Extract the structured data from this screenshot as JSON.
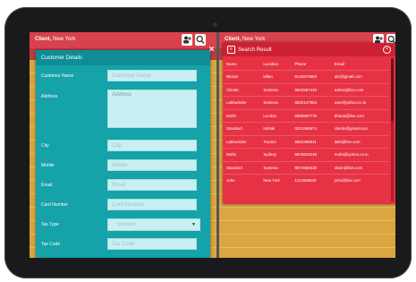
{
  "left": {
    "topbar_title": "Client,",
    "topbar_location": "New York",
    "panel_title": "Customer Details",
    "fields": [
      {
        "label": "Customer Name",
        "placeholder": "Customer Name"
      },
      {
        "label": "Address",
        "placeholder": "Address"
      },
      {
        "label": "City",
        "placeholder": "City"
      },
      {
        "label": "Mobile",
        "placeholder": "Mobile"
      },
      {
        "label": "Email",
        "placeholder": "Email"
      },
      {
        "label": "Card Number",
        "placeholder": "Card Number"
      },
      {
        "label": "Tax Type",
        "value": "Standard"
      },
      {
        "label": "Tax Code",
        "placeholder": "Tax Code"
      }
    ],
    "close": "×"
  },
  "right": {
    "topbar_title": "Client,",
    "topbar_location": "New York",
    "search_title": "Search Result",
    "columns": [
      "Name",
      "Location",
      "Phone",
      "Email"
    ],
    "rows": [
      [
        "Bharat",
        "Milan",
        "8125874963",
        "abr@gmail.com"
      ],
      [
        "Cliente",
        "Santena",
        "9632587410",
        "admin@live.com"
      ],
      [
        "Lakhwinder",
        "Santena",
        "8520147963",
        "user@yahoo.co.in"
      ],
      [
        "Mohit",
        "London",
        "9998887776",
        "bharat@live.com"
      ],
      [
        "Standard",
        "Mohali",
        "0021569874",
        "cliente@gmail.com"
      ],
      [
        "Lakhwinder",
        "Toronto",
        "8862366911",
        "lakh@live.com"
      ],
      [
        "Mohit",
        "Sydney",
        "9876543218",
        "mohit@yahoo.co.in"
      ],
      [
        "Standard",
        "Santena",
        "9874556630",
        "stann@live.com"
      ],
      [
        "John",
        "New York",
        "1112589630",
        "john@live.com"
      ]
    ]
  },
  "colors": {
    "topbar": "#d9424c",
    "panel": "#15a2a8",
    "search_panel": "#e73244",
    "background": "#d9a63f"
  },
  "icons": {
    "add_user": "add-user-icon",
    "search": "search-icon",
    "close": "close-icon"
  }
}
